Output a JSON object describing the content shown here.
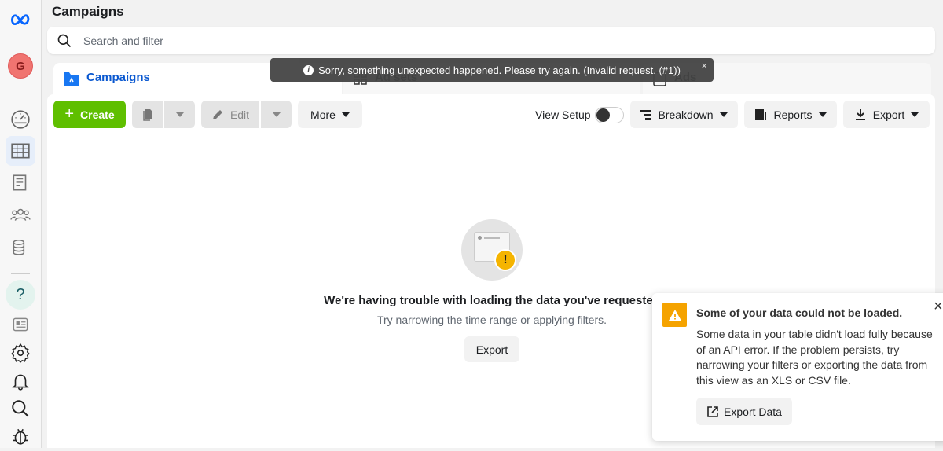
{
  "header": {
    "title": "Campaigns"
  },
  "search": {
    "placeholder": "Search and filter"
  },
  "sidebar": {
    "avatar_initial": "G",
    "icons": [
      "meta-logo-icon",
      "dashboard-icon",
      "campaigns-table-icon",
      "pages-icon",
      "audiences-icon",
      "billing-icon",
      "help-icon",
      "news-icon",
      "settings-icon",
      "notifications-icon",
      "search-icon",
      "bug-icon"
    ]
  },
  "tabs": [
    {
      "label": "Campaigns",
      "active": true
    },
    {
      "label": "Ad sets"
    },
    {
      "label": "Ads"
    }
  ],
  "toolbar": {
    "create": "Create",
    "edit": "Edit",
    "more": "More",
    "view_setup": "View Setup",
    "breakdown": "Breakdown",
    "reports": "Reports",
    "export": "Export"
  },
  "toast": {
    "message": "Sorry, something unexpected happened. Please try again. (Invalid request. (#1))",
    "close": "×"
  },
  "empty": {
    "heading": "We're having trouble with loading the data you've requested",
    "sub": "Try narrowing the time range or applying filters.",
    "export": "Export"
  },
  "popup": {
    "title": "Some of your data could not be loaded.",
    "body": "Some data in your table didn't load fully because of an API error. If the problem persists, try narrowing your filters or exporting the data from this view as an XLS or CSV file.",
    "button": "Export Data",
    "close": "×"
  },
  "colors": {
    "accent": "#1877f2",
    "create": "#5fbf00",
    "warning": "#f5a300"
  }
}
